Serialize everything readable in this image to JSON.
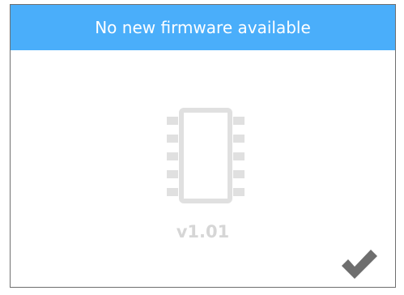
{
  "dialog": {
    "title": "No new firmware available",
    "version": "v1.01"
  },
  "icons": {
    "chip": "chip-icon",
    "confirm": "checkmark-icon"
  },
  "colors": {
    "header_bg": "#4aaefa",
    "header_text": "#ffffff",
    "icon_gray": "#e0e0e0",
    "version_gray": "#d6d6d6",
    "check_gray": "#6e6e6e"
  }
}
